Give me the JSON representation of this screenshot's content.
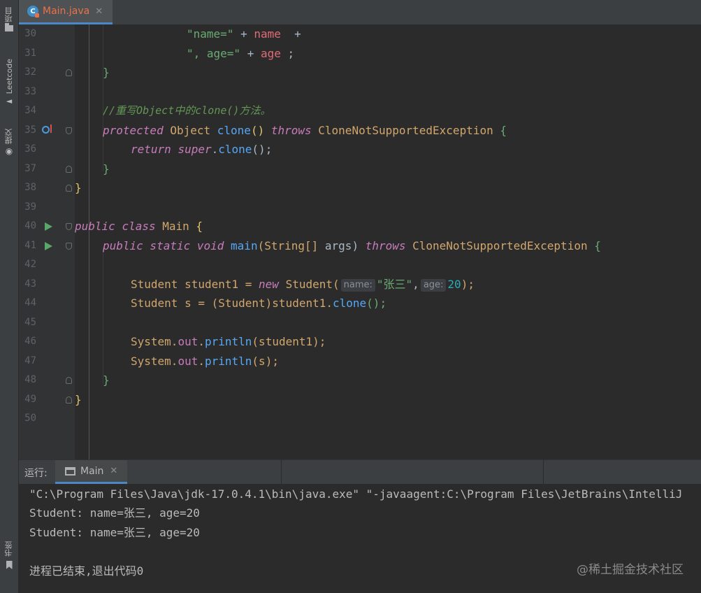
{
  "sidebar": {
    "project_label": "项目",
    "leetcode_label": "Leetcode",
    "commit_label": "提交",
    "bookmarks_label": "书签"
  },
  "tab": {
    "title": "Main.java",
    "icon_letter": "C"
  },
  "editor": {
    "lines": [
      {
        "n": "30"
      },
      {
        "n": "31"
      },
      {
        "n": "32"
      },
      {
        "n": "33"
      },
      {
        "n": "34"
      },
      {
        "n": "35"
      },
      {
        "n": "36"
      },
      {
        "n": "37"
      },
      {
        "n": "38"
      },
      {
        "n": "39"
      },
      {
        "n": "40"
      },
      {
        "n": "41"
      },
      {
        "n": "42"
      },
      {
        "n": "43"
      },
      {
        "n": "44"
      },
      {
        "n": "45"
      },
      {
        "n": "46"
      },
      {
        "n": "47"
      },
      {
        "n": "48"
      },
      {
        "n": "49"
      },
      {
        "n": "50"
      }
    ],
    "code": {
      "l30_str": "\"name=\"",
      "l30_plus": " + ",
      "l30_var": "name",
      "l30_plus2": "  +",
      "l31_str": "\", age=\"",
      "l31_plus": " + ",
      "l31_var": "age",
      "l31_semi": " ;",
      "l32_brace": "}",
      "l34_comment": "//重写Object中的clone()方法。",
      "l35_protected": "protected",
      "l35_object": " Object ",
      "l35_clone": "clone",
      "l35_parens": "() ",
      "l35_throws": "throws",
      "l35_exc": " CloneNotSupportedException ",
      "l35_brace": "{",
      "l36_return": "return",
      "l36_sp": " ",
      "l36_super": "super",
      "l36_dot": ".",
      "l36_clone": "clone",
      "l36_end": "();",
      "l37_brace": "}",
      "l38_brace": "}",
      "l40_public": "public",
      "l40_sp": " ",
      "l40_class": "class",
      "l40_name": " Main ",
      "l40_brace": "{",
      "l41_public": "public",
      "l41_static": " static",
      "l41_void": " void",
      "l41_main": " main",
      "l41_params": "(String[] ",
      "l41_args": "args",
      "l41_close": ") ",
      "l41_throws": "throws",
      "l41_exc": " CloneNotSupportedException ",
      "l41_brace": "{",
      "l43_a": "Student student1 = ",
      "l43_new": "new",
      "l43_b": " Student(",
      "l43_hint_name": "name:",
      "l43_str": "\"张三\"",
      "l43_comma": ",",
      "l43_hint_age": "age:",
      "l43_num": "20",
      "l43_end": ");",
      "l44_a": "Student s = ",
      "l44_cast": "(Student)",
      "l44_b": "student1.",
      "l44_clone": "clone",
      "l44_end": "();",
      "l46_sys": "System.",
      "l46_out": "out",
      "l46_dot": ".",
      "l46_println": "println",
      "l46_end": "(student1);",
      "l47_sys": "System.",
      "l47_out": "out",
      "l47_dot": ".",
      "l47_println": "println",
      "l47_end": "(s);",
      "l48_brace": "}",
      "l49_brace": "}"
    }
  },
  "run_panel": {
    "label": "运行:",
    "tab_title": "Main",
    "output": [
      "\"C:\\Program Files\\Java\\jdk-17.0.4.1\\bin\\java.exe\" \"-javaagent:C:\\Program Files\\JetBrains\\IntelliJ",
      "Student: name=张三, age=20",
      "Student: name=张三, age=20",
      "",
      "进程已结束,退出代码0"
    ]
  },
  "watermark": "@稀土掘金技术社区"
}
